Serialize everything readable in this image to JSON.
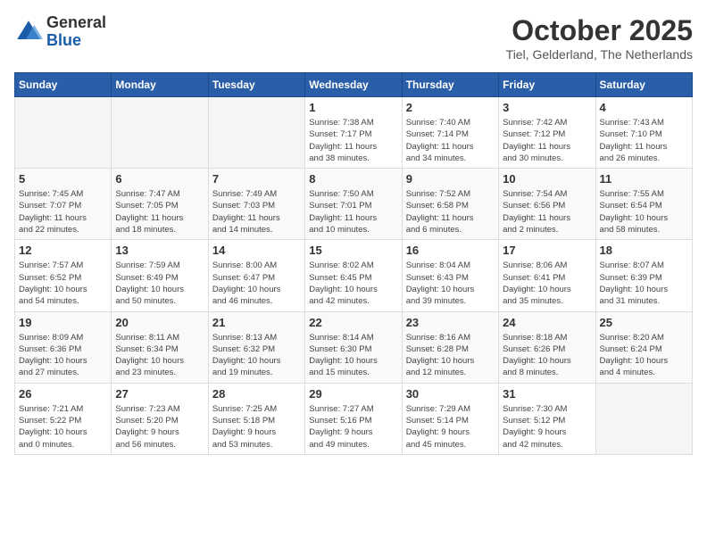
{
  "header": {
    "logo_general": "General",
    "logo_blue": "Blue",
    "month": "October 2025",
    "location": "Tiel, Gelderland, The Netherlands"
  },
  "weekdays": [
    "Sunday",
    "Monday",
    "Tuesday",
    "Wednesday",
    "Thursday",
    "Friday",
    "Saturday"
  ],
  "weeks": [
    [
      {
        "day": "",
        "info": ""
      },
      {
        "day": "",
        "info": ""
      },
      {
        "day": "",
        "info": ""
      },
      {
        "day": "1",
        "info": "Sunrise: 7:38 AM\nSunset: 7:17 PM\nDaylight: 11 hours\nand 38 minutes."
      },
      {
        "day": "2",
        "info": "Sunrise: 7:40 AM\nSunset: 7:14 PM\nDaylight: 11 hours\nand 34 minutes."
      },
      {
        "day": "3",
        "info": "Sunrise: 7:42 AM\nSunset: 7:12 PM\nDaylight: 11 hours\nand 30 minutes."
      },
      {
        "day": "4",
        "info": "Sunrise: 7:43 AM\nSunset: 7:10 PM\nDaylight: 11 hours\nand 26 minutes."
      }
    ],
    [
      {
        "day": "5",
        "info": "Sunrise: 7:45 AM\nSunset: 7:07 PM\nDaylight: 11 hours\nand 22 minutes."
      },
      {
        "day": "6",
        "info": "Sunrise: 7:47 AM\nSunset: 7:05 PM\nDaylight: 11 hours\nand 18 minutes."
      },
      {
        "day": "7",
        "info": "Sunrise: 7:49 AM\nSunset: 7:03 PM\nDaylight: 11 hours\nand 14 minutes."
      },
      {
        "day": "8",
        "info": "Sunrise: 7:50 AM\nSunset: 7:01 PM\nDaylight: 11 hours\nand 10 minutes."
      },
      {
        "day": "9",
        "info": "Sunrise: 7:52 AM\nSunset: 6:58 PM\nDaylight: 11 hours\nand 6 minutes."
      },
      {
        "day": "10",
        "info": "Sunrise: 7:54 AM\nSunset: 6:56 PM\nDaylight: 11 hours\nand 2 minutes."
      },
      {
        "day": "11",
        "info": "Sunrise: 7:55 AM\nSunset: 6:54 PM\nDaylight: 10 hours\nand 58 minutes."
      }
    ],
    [
      {
        "day": "12",
        "info": "Sunrise: 7:57 AM\nSunset: 6:52 PM\nDaylight: 10 hours\nand 54 minutes."
      },
      {
        "day": "13",
        "info": "Sunrise: 7:59 AM\nSunset: 6:49 PM\nDaylight: 10 hours\nand 50 minutes."
      },
      {
        "day": "14",
        "info": "Sunrise: 8:00 AM\nSunset: 6:47 PM\nDaylight: 10 hours\nand 46 minutes."
      },
      {
        "day": "15",
        "info": "Sunrise: 8:02 AM\nSunset: 6:45 PM\nDaylight: 10 hours\nand 42 minutes."
      },
      {
        "day": "16",
        "info": "Sunrise: 8:04 AM\nSunset: 6:43 PM\nDaylight: 10 hours\nand 39 minutes."
      },
      {
        "day": "17",
        "info": "Sunrise: 8:06 AM\nSunset: 6:41 PM\nDaylight: 10 hours\nand 35 minutes."
      },
      {
        "day": "18",
        "info": "Sunrise: 8:07 AM\nSunset: 6:39 PM\nDaylight: 10 hours\nand 31 minutes."
      }
    ],
    [
      {
        "day": "19",
        "info": "Sunrise: 8:09 AM\nSunset: 6:36 PM\nDaylight: 10 hours\nand 27 minutes."
      },
      {
        "day": "20",
        "info": "Sunrise: 8:11 AM\nSunset: 6:34 PM\nDaylight: 10 hours\nand 23 minutes."
      },
      {
        "day": "21",
        "info": "Sunrise: 8:13 AM\nSunset: 6:32 PM\nDaylight: 10 hours\nand 19 minutes."
      },
      {
        "day": "22",
        "info": "Sunrise: 8:14 AM\nSunset: 6:30 PM\nDaylight: 10 hours\nand 15 minutes."
      },
      {
        "day": "23",
        "info": "Sunrise: 8:16 AM\nSunset: 6:28 PM\nDaylight: 10 hours\nand 12 minutes."
      },
      {
        "day": "24",
        "info": "Sunrise: 8:18 AM\nSunset: 6:26 PM\nDaylight: 10 hours\nand 8 minutes."
      },
      {
        "day": "25",
        "info": "Sunrise: 8:20 AM\nSunset: 6:24 PM\nDaylight: 10 hours\nand 4 minutes."
      }
    ],
    [
      {
        "day": "26",
        "info": "Sunrise: 7:21 AM\nSunset: 5:22 PM\nDaylight: 10 hours\nand 0 minutes."
      },
      {
        "day": "27",
        "info": "Sunrise: 7:23 AM\nSunset: 5:20 PM\nDaylight: 9 hours\nand 56 minutes."
      },
      {
        "day": "28",
        "info": "Sunrise: 7:25 AM\nSunset: 5:18 PM\nDaylight: 9 hours\nand 53 minutes."
      },
      {
        "day": "29",
        "info": "Sunrise: 7:27 AM\nSunset: 5:16 PM\nDaylight: 9 hours\nand 49 minutes."
      },
      {
        "day": "30",
        "info": "Sunrise: 7:29 AM\nSunset: 5:14 PM\nDaylight: 9 hours\nand 45 minutes."
      },
      {
        "day": "31",
        "info": "Sunrise: 7:30 AM\nSunset: 5:12 PM\nDaylight: 9 hours\nand 42 minutes."
      },
      {
        "day": "",
        "info": ""
      }
    ]
  ]
}
